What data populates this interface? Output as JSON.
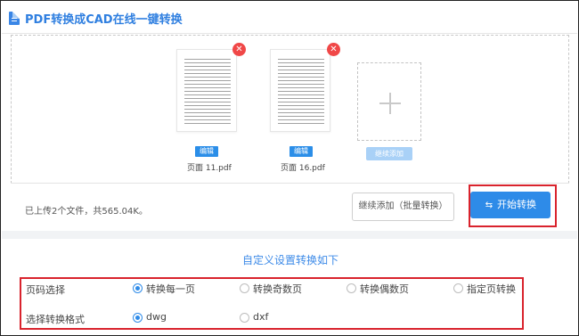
{
  "header": {
    "title": "PDF转换成CAD在线一键转换",
    "icon": "document-icon"
  },
  "files": [
    {
      "name": "页面 11.pdf",
      "edit_label": "编辑",
      "remove_icon": "close-icon"
    },
    {
      "name": "页面 16.pdf",
      "edit_label": "编辑",
      "remove_icon": "close-icon"
    }
  ],
  "add_box": {
    "icon": "plus-icon",
    "button_label": "继续添加"
  },
  "footer": {
    "uploaded_info": "已上传2个文件，共565.04K。",
    "batch_add_label": "继续添加（批量转换）",
    "convert_label": "开始转换",
    "convert_icon": "swap-icon"
  },
  "settings": {
    "title": "自定义设置转换如下",
    "page_select": {
      "label": "页码选择",
      "options": [
        "转换每一页",
        "转换奇数页",
        "转换偶数页",
        "指定页转换"
      ],
      "selected": "转换每一页"
    },
    "format_select": {
      "label": "选择转换格式",
      "options": [
        "dwg",
        "dxf"
      ],
      "selected": "dwg"
    }
  },
  "colors": {
    "accent": "#2e8be8",
    "highlight": "#d9232d",
    "remove": "#f04747"
  }
}
